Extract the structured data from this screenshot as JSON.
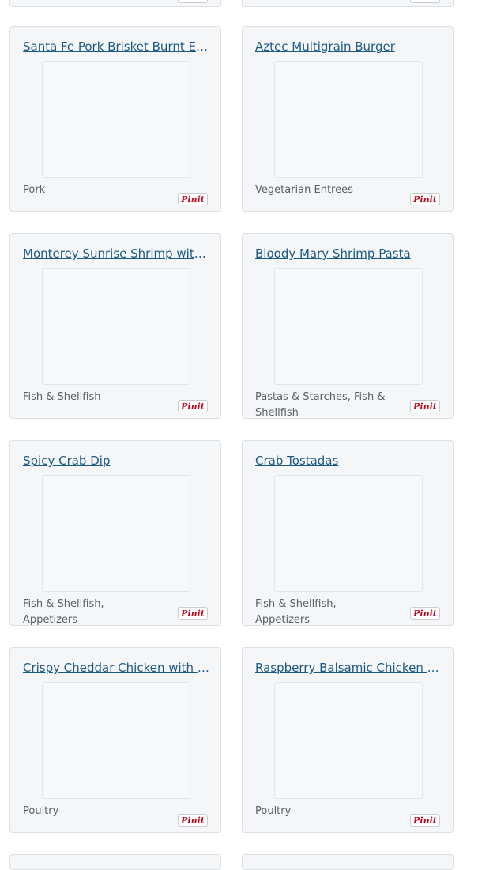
{
  "pin_label": "Pinit",
  "recipes": [
    {
      "title": "Santa Fe Pork Brisket Burnt Ends",
      "category": "Pork"
    },
    {
      "title": "Aztec Multigrain Burger",
      "category": "Vegetarian Entrees"
    },
    {
      "title": "Monterey Sunrise Shrimp with Zucchini",
      "category": "Fish & Shellfish"
    },
    {
      "title": "Bloody Mary Shrimp Pasta",
      "category": "Pastas & Starches, Fish & Shellfish"
    },
    {
      "title": "Spicy Crab Dip",
      "category": "Fish & Shellfish, Appetizers"
    },
    {
      "title": "Crab Tostadas",
      "category": "Fish & Shellfish, Appetizers"
    },
    {
      "title": "Crispy Cheddar Chicken with Asparagus",
      "category": "Poultry"
    },
    {
      "title": "Raspberry Balsamic Chicken with Greens",
      "category": "Poultry"
    }
  ]
}
